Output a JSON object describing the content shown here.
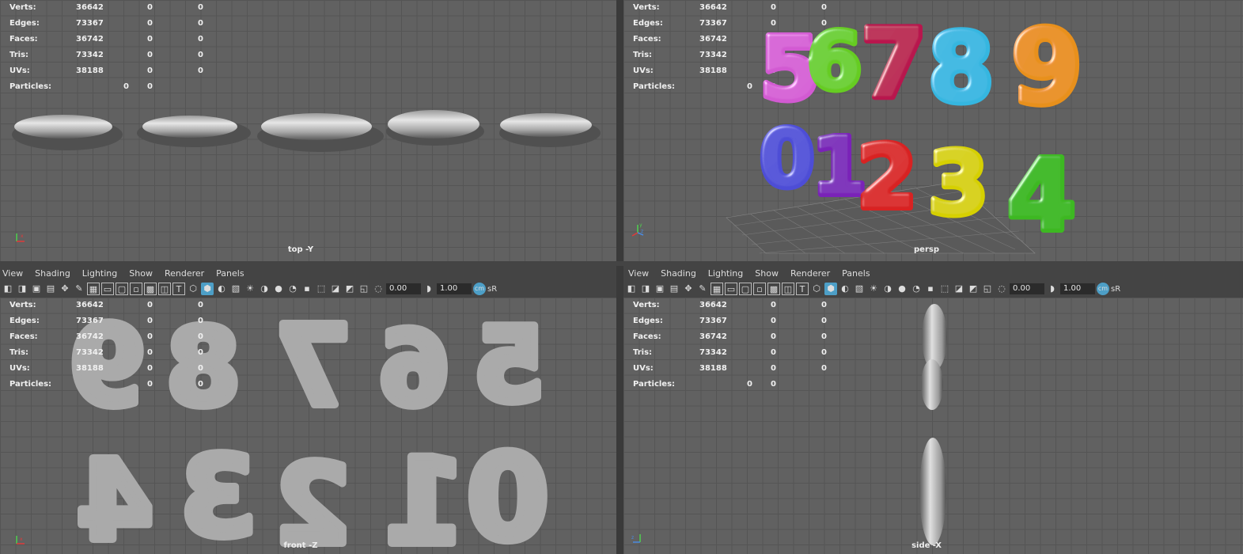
{
  "hud": {
    "labels": {
      "verts": "Verts:",
      "edges": "Edges:",
      "faces": "Faces:",
      "tris": "Tris:",
      "uvs": "UVs:",
      "particles": "Particles:"
    },
    "values": {
      "verts": [
        "36642",
        "0",
        "0"
      ],
      "edges": [
        "73367",
        "0",
        "0"
      ],
      "faces": [
        "36742",
        "0",
        "0"
      ],
      "tris": [
        "73342",
        "0",
        "0"
      ],
      "uvs": [
        "38188",
        "0",
        "0"
      ],
      "particles": [
        "0",
        "0"
      ]
    }
  },
  "viewports": {
    "top": {
      "camera": "top -Y"
    },
    "persp": {
      "camera": "persp"
    },
    "front": {
      "camera": "front -Z"
    },
    "side": {
      "camera": "side -X"
    }
  },
  "menu": [
    "View",
    "Shading",
    "Lighting",
    "Show",
    "Renderer",
    "Panels"
  ],
  "toolbar": {
    "field1": "0.00",
    "field2": "1.00",
    "sr_label": "sR"
  },
  "axis": {
    "x": "x",
    "y": "y",
    "z": "z"
  },
  "digits": {
    "top_row": [
      "5",
      "6",
      "7",
      "8",
      "9"
    ],
    "bottom_row": [
      "0",
      "1",
      "2",
      "3",
      "4"
    ],
    "colors": {
      "5": "#d25ad2",
      "6": "#66cc22",
      "7": "#b8154e",
      "8": "#36b6e0",
      "9": "#e8901a",
      "0": "#4d4dd6",
      "1": "#7a22b8",
      "2": "#d82222",
      "3": "#d6d000",
      "4": "#3db820"
    }
  }
}
